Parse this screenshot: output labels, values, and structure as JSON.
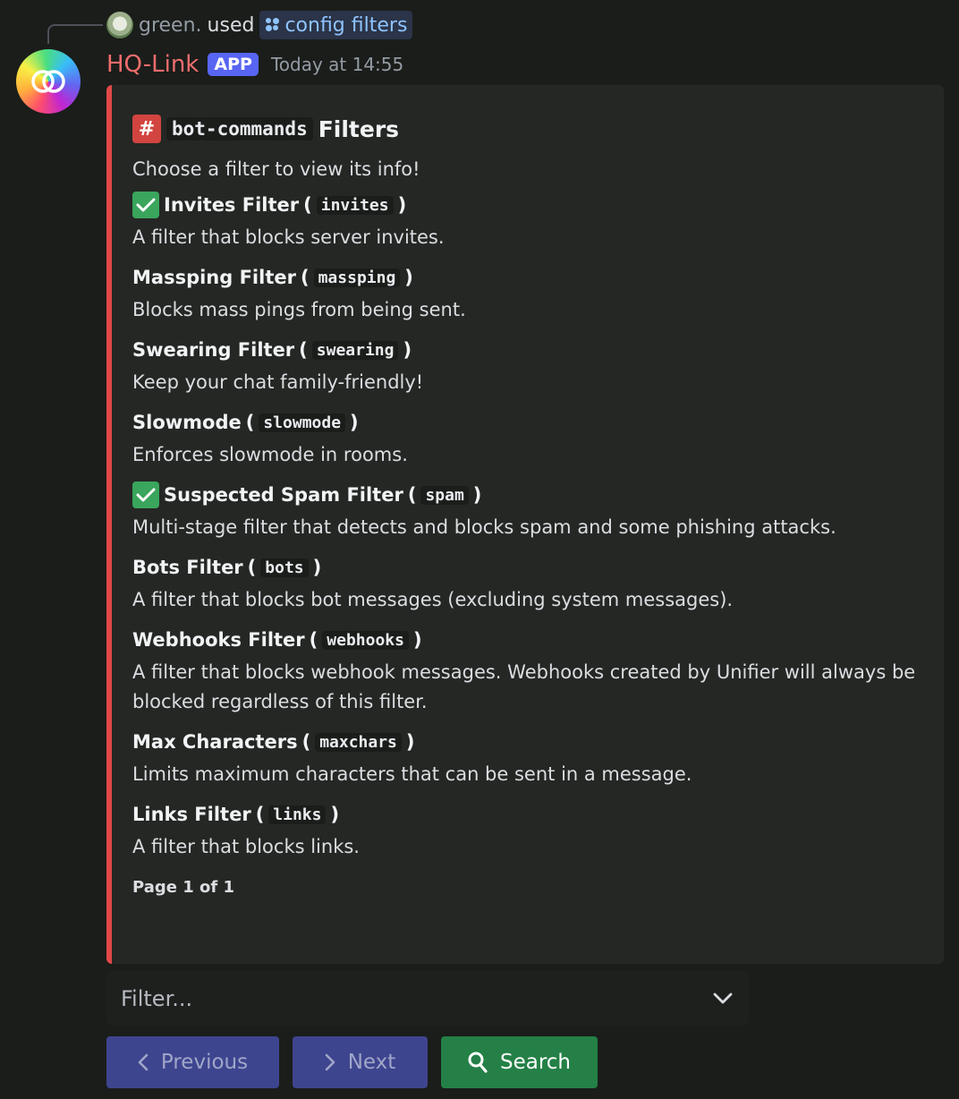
{
  "reply": {
    "user": "green.",
    "used": "used",
    "command": "config filters"
  },
  "header": {
    "bot_name": "HQ-Link",
    "tag": "APP",
    "timestamp": "Today at 14:55"
  },
  "embed": {
    "accent": "#e24848",
    "title_channel": "bot-commands",
    "title_suffix": "Filters",
    "description": "Choose a filter to view its info!",
    "fields": [
      {
        "checked": true,
        "name": "Invites Filter",
        "code": "invites",
        "value": "A filter that blocks server invites."
      },
      {
        "checked": false,
        "name": "Massping Filter",
        "code": "massping",
        "value": "Blocks mass pings from being sent."
      },
      {
        "checked": false,
        "name": "Swearing Filter",
        "code": "swearing",
        "value": "Keep your chat family-friendly!"
      },
      {
        "checked": false,
        "name": "Slowmode",
        "code": "slowmode",
        "value": "Enforces slowmode in rooms."
      },
      {
        "checked": true,
        "name": "Suspected Spam Filter",
        "code": "spam",
        "value": "Multi-stage filter that detects and blocks spam and some phishing attacks."
      },
      {
        "checked": false,
        "name": "Bots Filter",
        "code": "bots",
        "value": "A filter that blocks bot messages (excluding system messages)."
      },
      {
        "checked": false,
        "name": "Webhooks Filter",
        "code": "webhooks",
        "value": "A filter that blocks webhook messages. Webhooks created by Unifier will always be blocked regardless of this filter."
      },
      {
        "checked": false,
        "name": "Max Characters",
        "code": "maxchars",
        "value": "Limits maximum characters that can be sent in a message."
      },
      {
        "checked": false,
        "name": "Links Filter",
        "code": "links",
        "value": "A filter that blocks links."
      }
    ],
    "footer": "Page 1 of 1"
  },
  "select": {
    "placeholder": "Filter..."
  },
  "buttons": {
    "previous": "Previous",
    "next": "Next",
    "search": "Search"
  }
}
